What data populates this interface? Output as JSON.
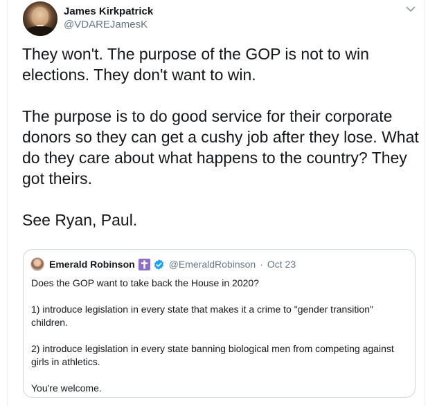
{
  "author": {
    "name": "James Kirkpatrick",
    "handle": "@VDAREJamesK"
  },
  "tweet": {
    "paragraphs": [
      "They won't. The purpose of the GOP is not to win elections. They don't want to win.",
      "The purpose is to do good service for their corporate donors so they can get a cushy job after they lose. What do they care about what happens to the country? They got theirs.",
      "See Ryan, Paul."
    ]
  },
  "quoted": {
    "name": "Emerald Robinson",
    "handle": "@EmeraldRobinson",
    "separator": "·",
    "date": "Oct 23",
    "paragraphs": [
      "Does the GOP want to take back the House in 2020?",
      "1) introduce legislation in every state that makes it a crime to \"gender transition\" children.",
      "2) introduce legislation in every state banning biological men from competing against girls in athletics.",
      "You're welcome."
    ]
  },
  "icons": {
    "menu": "chevron-down-icon",
    "verified": "verified-badge-icon",
    "emoji": "latin-cross-icon"
  },
  "colors": {
    "text": "#14171a",
    "secondary": "#657786",
    "verified": "#1da1f2",
    "emoji_bg": "#8b6fc4",
    "border": "#ccd6dd"
  }
}
